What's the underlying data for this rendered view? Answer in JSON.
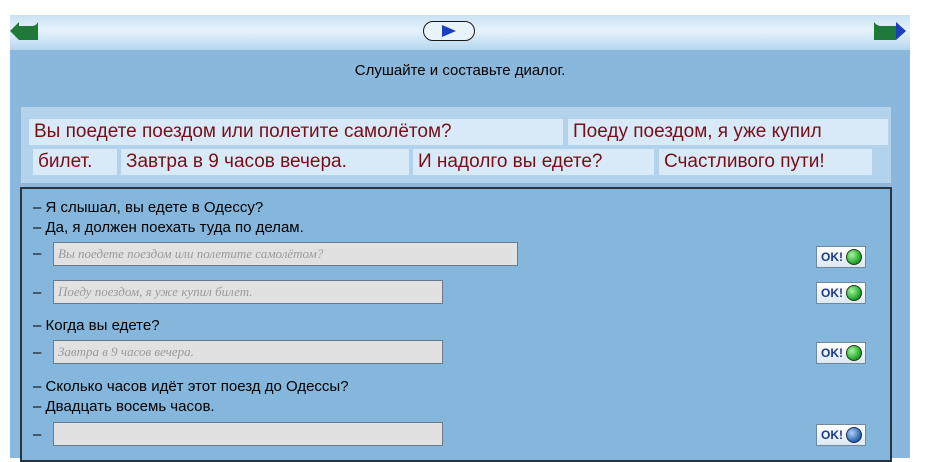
{
  "nav": {
    "back_icon": "arrow-left-icon",
    "play_icon": "play-icon",
    "forward_icon": "arrow-right-icon"
  },
  "instruction": "Слушайте и составьте диалог.",
  "phrases": [
    "Вы поедете поездом или полетите самолётом?",
    "Поеду поездом, я уже купил",
    "билет.",
    "Завтра в 9 часов вечера.",
    "И надолго вы едете?",
    "Счастливого пути!"
  ],
  "dialog": {
    "line1": "– Я слышал, вы едете в Одессу?",
    "line2": "– Да, я должен поехать туда по делам.",
    "dash": "–",
    "answer1": "Вы поедете поездом или полетите самолётом?",
    "answer2": "Поеду поездом, я уже купил билет.",
    "line3": "– Когда вы едете?",
    "answer3": "Завтра в 9 часов вечера.",
    "line4": "– Сколько часов идёт этот поезд до Одессы?",
    "line5": "– Двадцать восемь часов.",
    "answer4": ""
  },
  "ok_label": "OK!",
  "colors": {
    "phrase_text": "#7a0e17",
    "background": "#8ab8dc",
    "lamp_ok": "#1fa82a",
    "lamp_pending": "#2c66b4"
  }
}
